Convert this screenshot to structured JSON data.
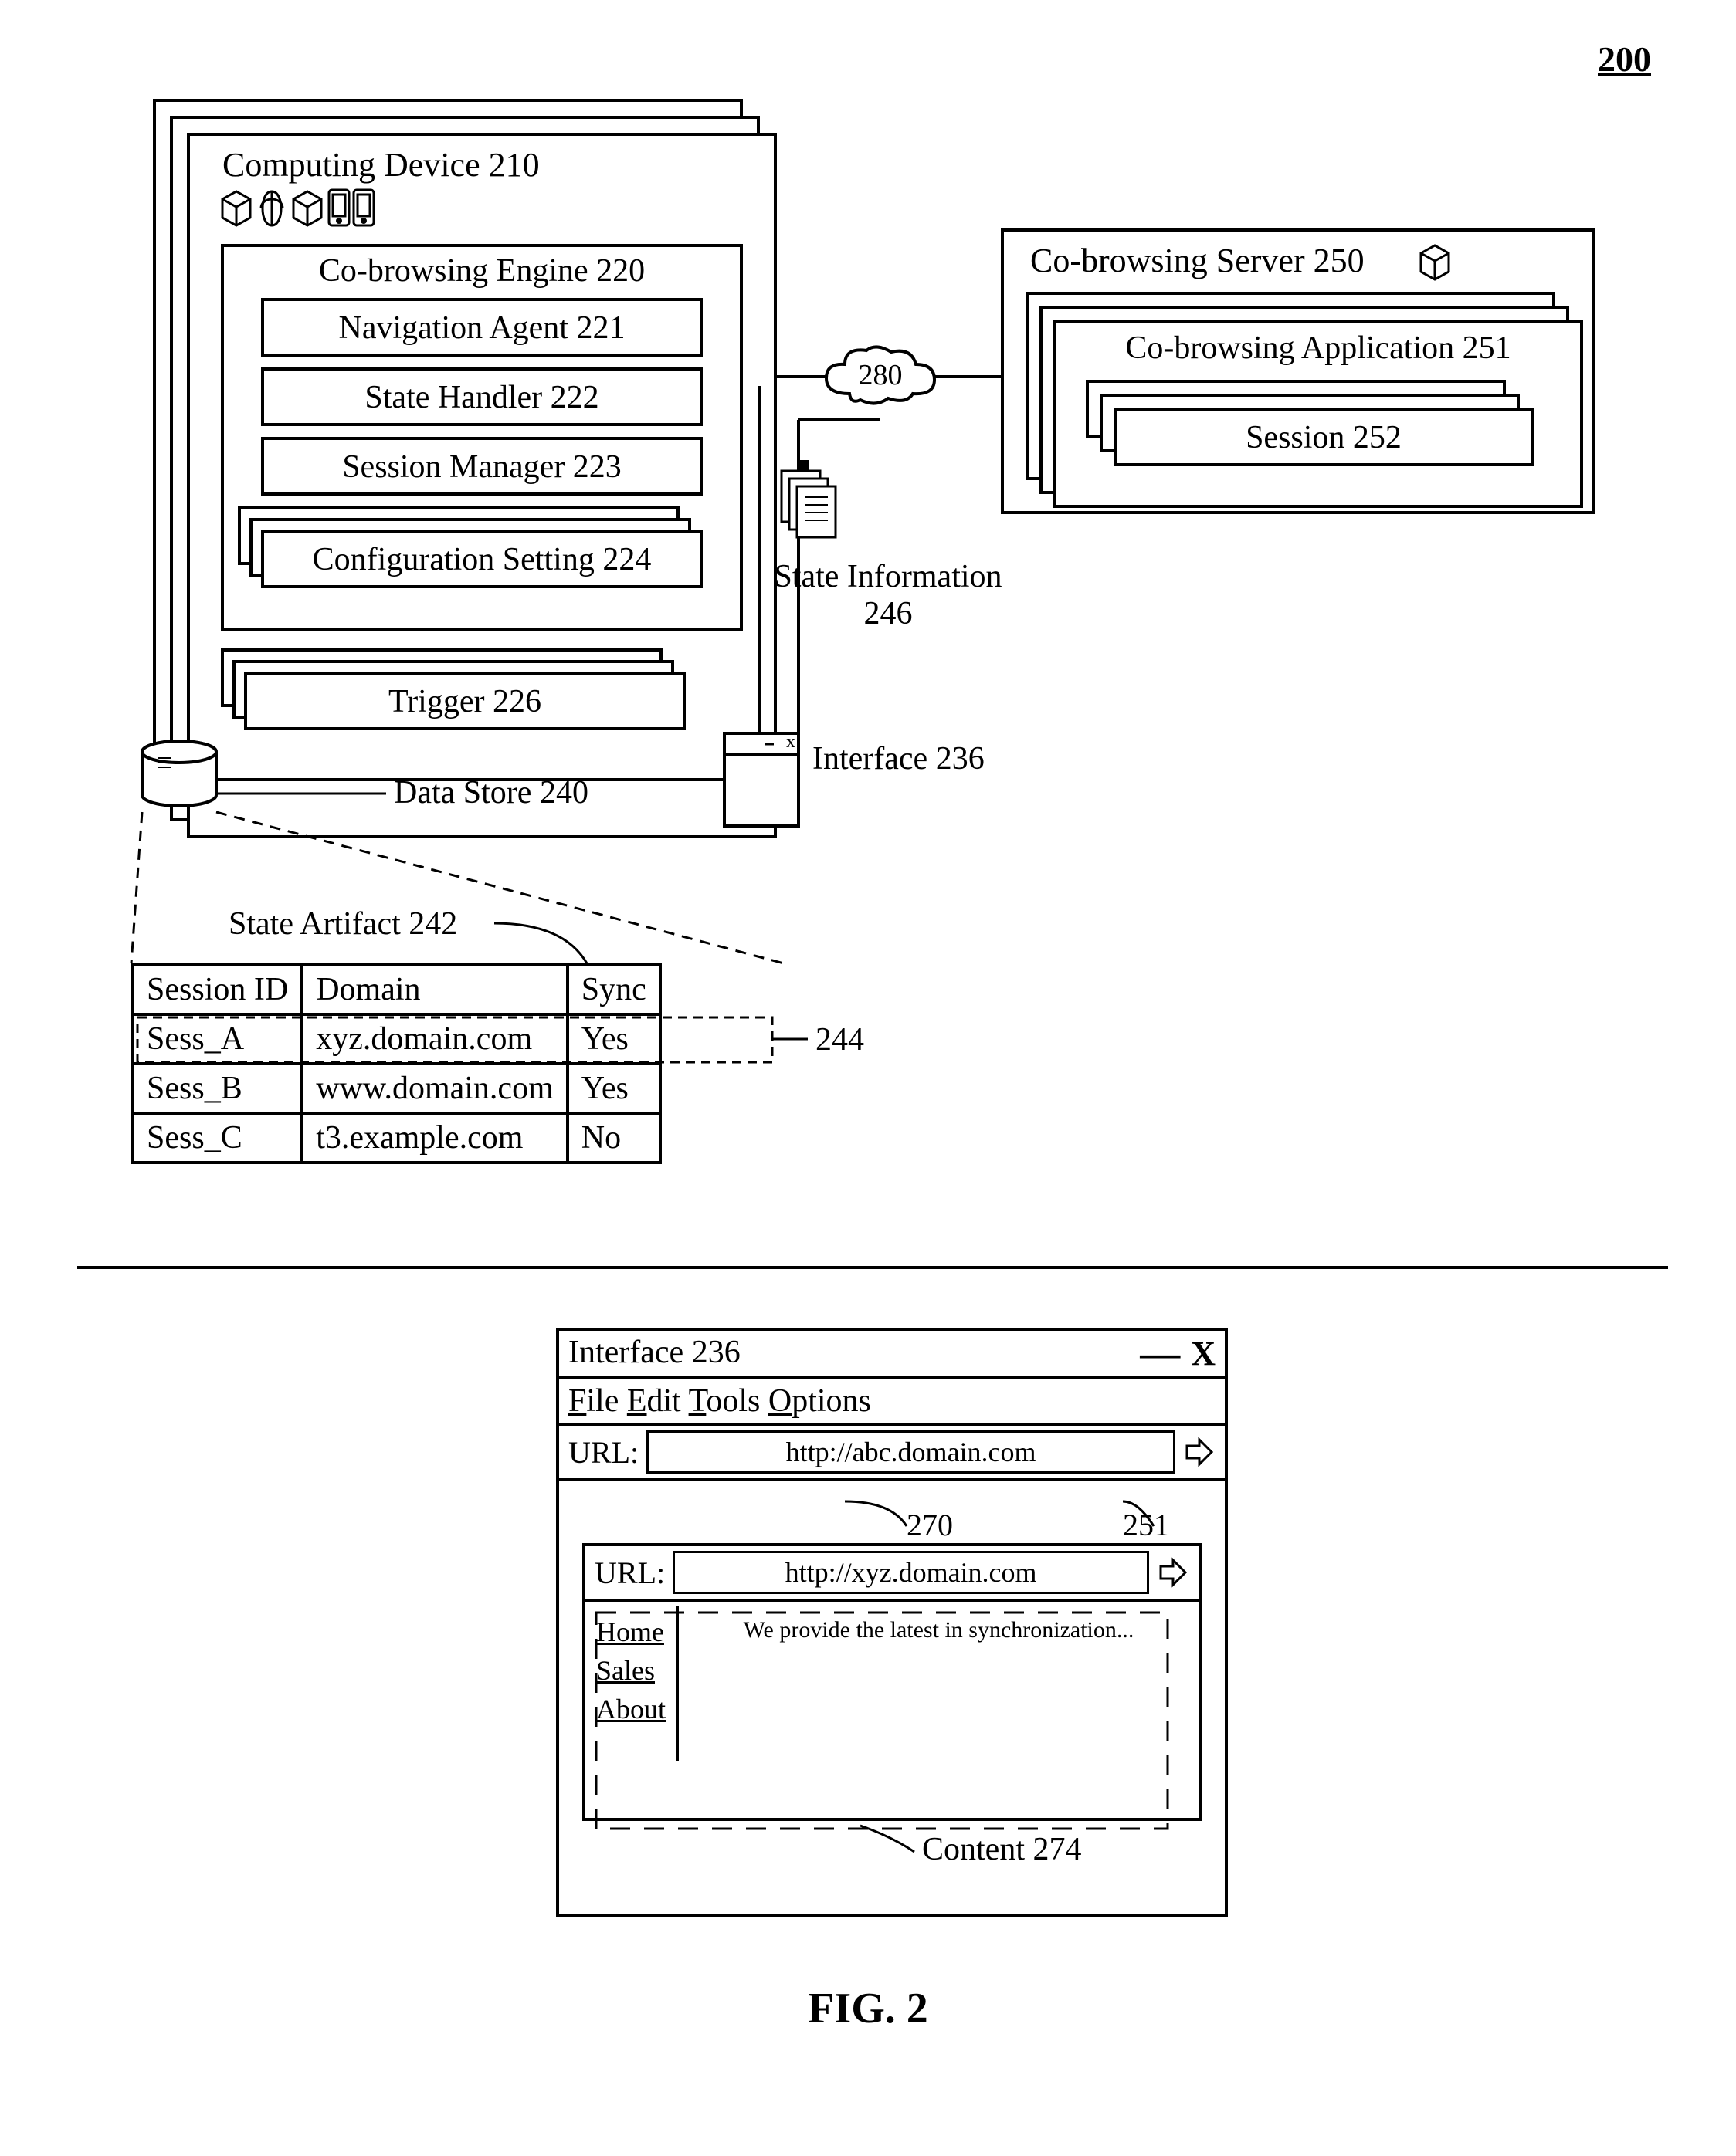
{
  "figure_number": "200",
  "caption": "FIG. 2",
  "device": {
    "title": "Computing Device 210",
    "engine": "Co-browsing Engine 220",
    "components": [
      "Navigation Agent 221",
      "State Handler 222",
      "Session Manager 223",
      "Configuration Setting 224"
    ],
    "trigger": "Trigger 226"
  },
  "network_label": "280",
  "server": {
    "title": "Co-browsing Server 250",
    "app": "Co-browsing Application 251",
    "session": "Session 252"
  },
  "state_info": "State Information 246",
  "interface_label": "Interface 236",
  "data_store": "Data Store 240",
  "artifact_label": "State Artifact 242",
  "row_ref": "244",
  "table": {
    "headers": [
      "Session ID",
      "Domain",
      "Sync"
    ],
    "rows": [
      [
        "Sess_A",
        "xyz.domain.com",
        "Yes"
      ],
      [
        "Sess_B",
        "www.domain.com",
        "Yes"
      ],
      [
        "Sess_C",
        "t3.example.com",
        "No"
      ]
    ]
  },
  "browser": {
    "title": "Interface 236",
    "menu": [
      "File",
      "Edit",
      "Tools",
      "Options"
    ],
    "url_label": "URL:",
    "outer_url": "http://abc.domain.com",
    "outer_ref": "270",
    "inner_ref": "251",
    "inner_url": "http://xyz.domain.com",
    "links": [
      "Home",
      "Sales",
      "About"
    ],
    "content_text": "We provide the latest in synchronization...",
    "content_label": "Content 274"
  }
}
